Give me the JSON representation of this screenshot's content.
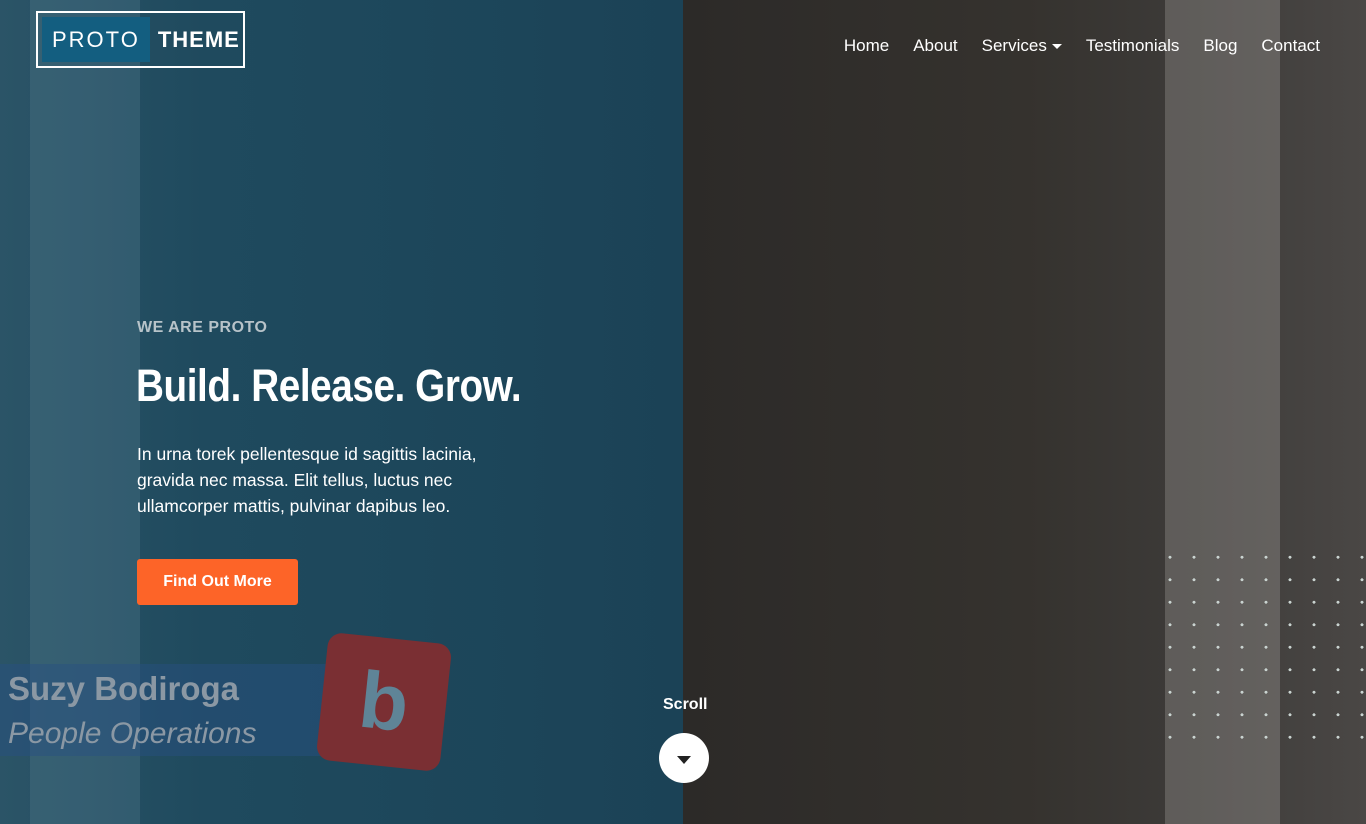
{
  "logo": {
    "part1": "PROTO",
    "part2": "THEME"
  },
  "nav": {
    "items": [
      {
        "label": "Home"
      },
      {
        "label": "About"
      },
      {
        "label": "Services",
        "has_dropdown": true
      },
      {
        "label": "Testimonials"
      },
      {
        "label": "Blog"
      },
      {
        "label": "Contact"
      }
    ]
  },
  "hero": {
    "eyebrow": "WE ARE PROTO",
    "title": "Build. Release. Grow.",
    "description": "In urna torek pellentesque id sagittis lacinia, gravida nec massa. Elit tellus, luctus nec ullamcorper mattis, pulvinar dapibus leo.",
    "cta_label": "Find Out More"
  },
  "video_caption": {
    "name": "Suzy Bodiroga",
    "role": "People Operations",
    "badge": "b"
  },
  "scroll": {
    "label": "Scroll"
  },
  "colors": {
    "accent": "#fd6428",
    "brand": "#135e80",
    "overlay": "#1d475b"
  }
}
